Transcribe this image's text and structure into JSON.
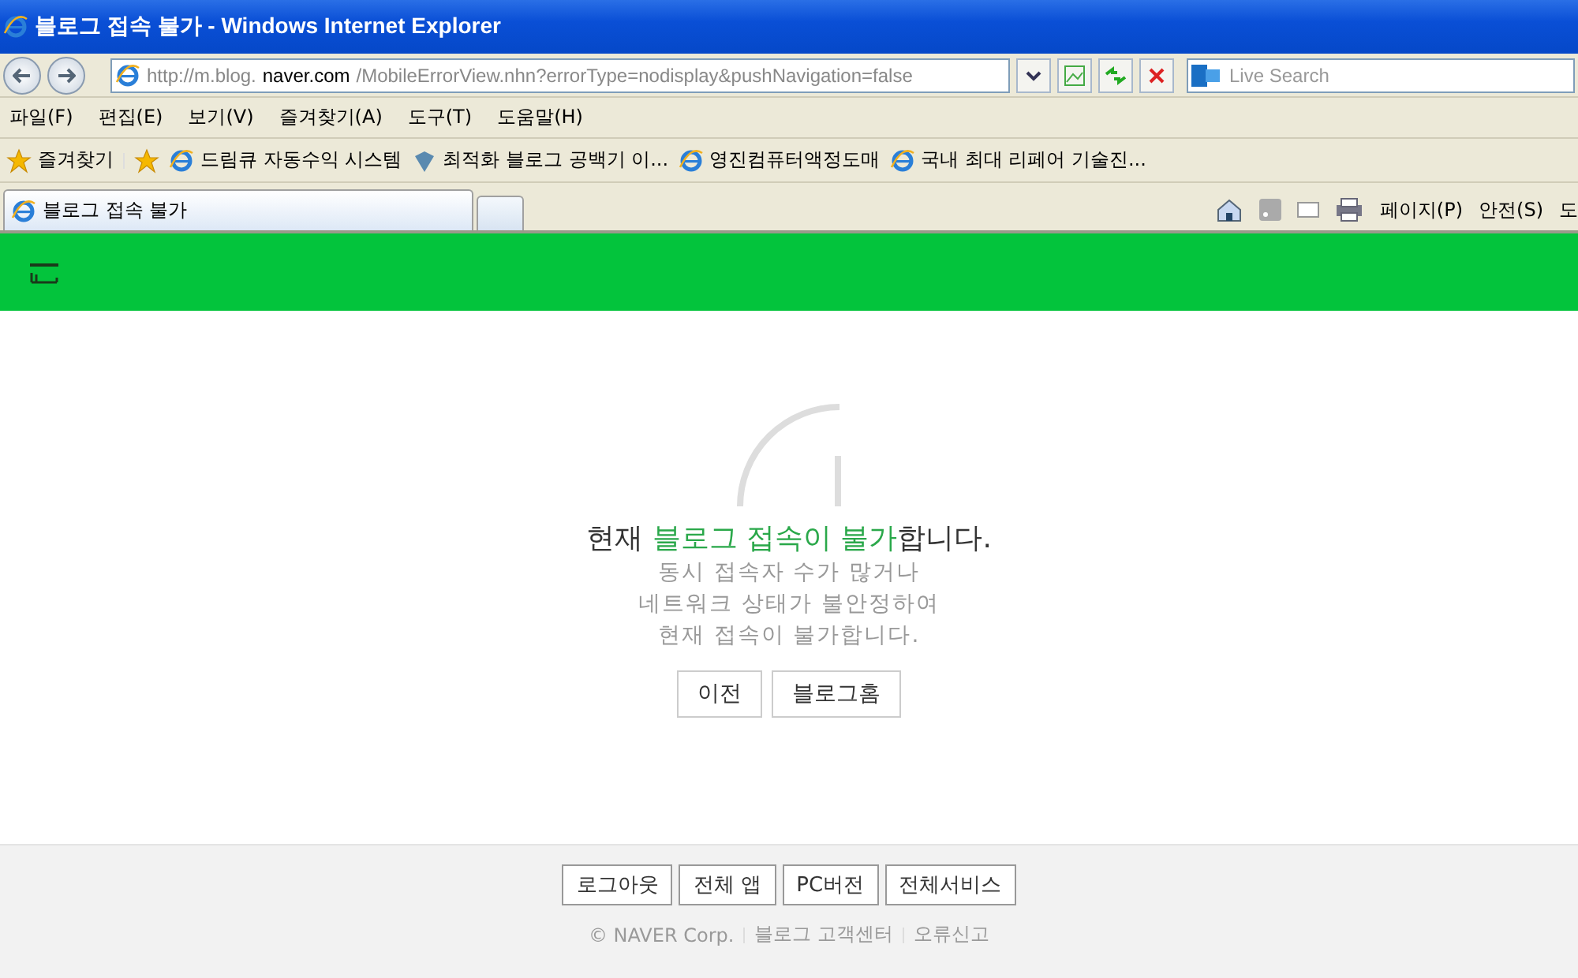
{
  "window": {
    "title": "블로그 접속 불가 - Windows Internet Explorer"
  },
  "address_bar": {
    "url_prefix": "http://m.blog.",
    "url_host": "naver.com",
    "url_rest": "/MobileErrorView.nhn?errorType=nodisplay&pushNavigation=false"
  },
  "search": {
    "placeholder": "Live Search"
  },
  "menu": [
    "파일(F)",
    "편집(E)",
    "보기(V)",
    "즐겨찾기(A)",
    "도구(T)",
    "도움말(H)"
  ],
  "favorites_bar": {
    "label": "즐겨찾기",
    "links": [
      {
        "label": "드림큐 자동수익 시스템",
        "kind": "page"
      },
      {
        "label": "최적화 블로그 공백기 이...",
        "kind": "gem"
      },
      {
        "label": "영진컴퓨터액정도매",
        "kind": "page"
      },
      {
        "label": "국내 최대 리페어 기술진...",
        "kind": "page"
      }
    ]
  },
  "tabs": [
    {
      "label": "블로그 접속 불가",
      "selected": true
    }
  ],
  "command_bar": [
    "페이지(P)",
    "안전(S)",
    "도"
  ],
  "error": {
    "headline": [
      {
        "text": "현재 ",
        "highlight": false
      },
      {
        "text": "블로그 접속이 불가",
        "highlight": true
      },
      {
        "text": "합니다.",
        "highlight": false
      }
    ],
    "lines": [
      "동시 접속자 수가 많거나",
      "네트워크 상태가 불안정하여",
      "현재 접속이 불가합니다."
    ],
    "buttons": [
      "이전",
      "블로그홈"
    ]
  },
  "footer": {
    "buttons": [
      "로그아웃",
      "전체 앱",
      "PC버전",
      "전체서비스"
    ],
    "links": [
      "© NAVER Corp.",
      "블로그 고객센터",
      "오류신고"
    ]
  }
}
